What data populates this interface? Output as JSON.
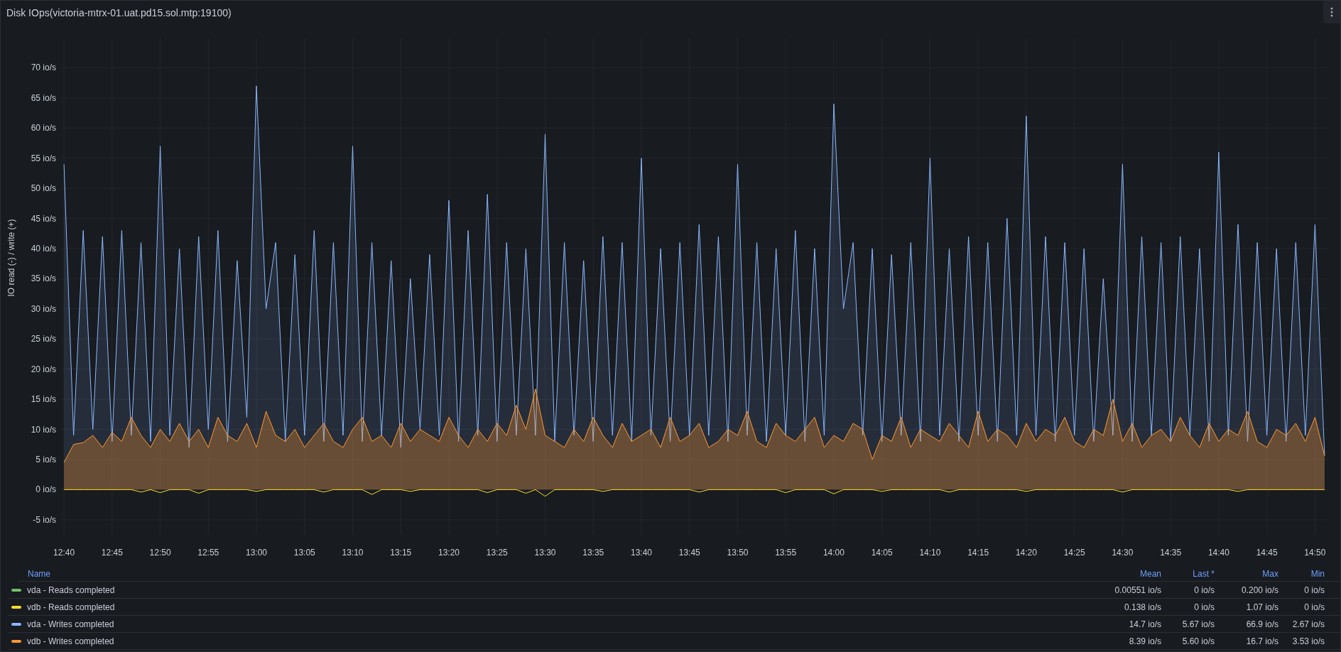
{
  "panel": {
    "title": "Disk IOps(victoria-mtrx-01.uat.pd15.sol.mtp:19100)",
    "chart_data": {
      "type": "area",
      "ylabel": "IO read (-) / write (+)",
      "stacked": false,
      "categories": [
        "12:40",
        null,
        null,
        null,
        null,
        "12:45",
        null,
        null,
        null,
        null,
        "12:50",
        null,
        null,
        null,
        null,
        "12:55",
        null,
        null,
        null,
        null,
        "13:00",
        null,
        null,
        null,
        null,
        "13:05",
        null,
        null,
        null,
        null,
        "13:10",
        null,
        null,
        null,
        null,
        "13:15",
        null,
        null,
        null,
        null,
        "13:20",
        null,
        null,
        null,
        null,
        "13:25",
        null,
        null,
        null,
        null,
        "13:30",
        null,
        null,
        null,
        null,
        "13:35",
        null,
        null,
        null,
        null,
        "13:40",
        null,
        null,
        null,
        null,
        "13:45",
        null,
        null,
        null,
        null,
        "13:50",
        null,
        null,
        null,
        null,
        "13:55",
        null,
        null,
        null,
        null,
        "14:00",
        null,
        null,
        null,
        null,
        "14:05",
        null,
        null,
        null,
        null,
        "14:10",
        null,
        null,
        null,
        null,
        "14:15",
        null,
        null,
        null,
        null,
        "14:20",
        null,
        null,
        null,
        null,
        "14:25",
        null,
        null,
        null,
        null,
        "14:30",
        null,
        null,
        null,
        null,
        "14:35",
        null,
        null,
        null,
        null,
        "14:40",
        null,
        null,
        null,
        null,
        "14:45",
        null,
        null,
        null,
        null,
        "14:50",
        null
      ],
      "ylim": [
        -7.5,
        75
      ],
      "grid": true,
      "yticks": [
        {
          "value": -5,
          "label": "-5 io/s"
        },
        {
          "value": 0,
          "label": "0 io/s"
        },
        {
          "value": 5,
          "label": "5 io/s"
        },
        {
          "value": 10,
          "label": "10 io/s"
        },
        {
          "value": 15,
          "label": "15 io/s"
        },
        {
          "value": 20,
          "label": "20 io/s"
        },
        {
          "value": 25,
          "label": "25 io/s"
        },
        {
          "value": 30,
          "label": "30 io/s"
        },
        {
          "value": 35,
          "label": "35 io/s"
        },
        {
          "value": 40,
          "label": "40 io/s"
        },
        {
          "value": 45,
          "label": "45 io/s"
        },
        {
          "value": 50,
          "label": "50 io/s"
        },
        {
          "value": 55,
          "label": "55 io/s"
        },
        {
          "value": 60,
          "label": "60 io/s"
        },
        {
          "value": 65,
          "label": "65 io/s"
        },
        {
          "value": 70,
          "label": "70 io/s"
        }
      ],
      "series": [
        {
          "name": "vda - Reads completed",
          "type": "line",
          "color": "#73bf69",
          "values": [
            null,
            null,
            null,
            null,
            null,
            null,
            null,
            null,
            null,
            null,
            null,
            null,
            null,
            null,
            null,
            null,
            null,
            null,
            null,
            null,
            null,
            null,
            null,
            null,
            null,
            null,
            null,
            null,
            null,
            null,
            null,
            null,
            null,
            null,
            null,
            null,
            null,
            null,
            null,
            null,
            null,
            null,
            null,
            null,
            null,
            null,
            null,
            null,
            null,
            null,
            null,
            null,
            null,
            null,
            null,
            null,
            null,
            null,
            null,
            null,
            null,
            null,
            null,
            null,
            null,
            null,
            null,
            null,
            null,
            null,
            null,
            null,
            null,
            null,
            null,
            null,
            null,
            null,
            null,
            null,
            null,
            null,
            null,
            null,
            null,
            null,
            null,
            null,
            null,
            null,
            null,
            null,
            null,
            null,
            null,
            null,
            null,
            null,
            null,
            null,
            null,
            null,
            null,
            null,
            null,
            null,
            null,
            null,
            null,
            null,
            null,
            null,
            null,
            null,
            null,
            null,
            null,
            null,
            null,
            null,
            null,
            null,
            null,
            null,
            null,
            null,
            null,
            null,
            null,
            null,
            null,
            null
          ]
        },
        {
          "name": "vdb - Reads completed",
          "type": "line",
          "color": "#fade2a",
          "values": [
            0,
            0,
            0,
            0,
            0,
            0,
            0,
            0,
            -0.4,
            0,
            -0.5,
            0,
            0,
            0,
            -0.6,
            0,
            0,
            0,
            0,
            0,
            -0.3,
            0,
            0,
            0,
            0,
            0,
            0,
            -0.4,
            0,
            0,
            0,
            0,
            -0.8,
            0,
            0,
            0,
            -0.3,
            0,
            0,
            0,
            0,
            0,
            0,
            0,
            -0.5,
            0,
            0,
            0,
            -0.6,
            0,
            -1.1,
            0,
            0,
            0,
            0,
            0,
            -0.3,
            0,
            0,
            0,
            0,
            0,
            0,
            0,
            0,
            0,
            -0.4,
            0,
            0,
            0,
            0,
            0,
            0,
            0,
            0,
            -0.5,
            0,
            0,
            0,
            0,
            -0.7,
            0,
            0,
            0,
            0,
            -0.3,
            0,
            0,
            0,
            0,
            0,
            0,
            -0.4,
            0,
            0,
            0,
            0,
            0,
            0,
            0,
            -0.3,
            0,
            0,
            0,
            0,
            0,
            0,
            0,
            0,
            0,
            -0.4,
            0,
            0,
            0,
            0,
            0,
            0,
            0,
            0,
            0,
            0,
            0,
            -0.3,
            0,
            0,
            0,
            0,
            0,
            0,
            0,
            0,
            0
          ]
        },
        {
          "name": "vda - Writes completed",
          "type": "area",
          "color": "#8ab8ff",
          "values": [
            54,
            9,
            43,
            10,
            42,
            8,
            43,
            9,
            41,
            8,
            57,
            9,
            40,
            7,
            42,
            10,
            43,
            8,
            38,
            12,
            67,
            30,
            41,
            8,
            39,
            9,
            43,
            8,
            41,
            9,
            57,
            8,
            41,
            9,
            38,
            7,
            35,
            10,
            39,
            9,
            48,
            8,
            43,
            9,
            49,
            8,
            41,
            9,
            40,
            9,
            59,
            8,
            41,
            9,
            38,
            8,
            42,
            9,
            41,
            8,
            55,
            9,
            40,
            8,
            41,
            9,
            44,
            9,
            42,
            8,
            54,
            9,
            41,
            8,
            40,
            9,
            43,
            8,
            40,
            9,
            64,
            30,
            41,
            9,
            40,
            8,
            39,
            9,
            41,
            8,
            55,
            9,
            40,
            8,
            42,
            9,
            41,
            8,
            45,
            9,
            62,
            9,
            42,
            8,
            41,
            9,
            40,
            8,
            35,
            9,
            54,
            8,
            42,
            9,
            41,
            8,
            42,
            9,
            40,
            8,
            56,
            9,
            44,
            8,
            41,
            9,
            40,
            8,
            41,
            9,
            44,
            5.7
          ]
        },
        {
          "name": "vdb - Writes completed",
          "type": "area",
          "color": "#ff9830",
          "values": [
            4.5,
            7.5,
            7.8,
            9,
            7,
            9.5,
            8,
            12,
            9,
            7,
            10,
            8,
            11,
            8,
            10,
            7,
            12,
            9,
            8,
            11,
            7,
            13,
            9,
            8,
            10,
            7,
            9,
            11,
            8,
            7,
            10,
            12,
            8,
            9,
            7,
            11,
            8,
            10,
            9,
            8,
            12,
            9,
            7,
            10,
            8,
            11,
            9,
            14,
            10,
            16.7,
            9,
            8,
            7,
            10,
            8,
            12,
            9,
            7,
            11,
            8,
            9,
            10,
            7,
            12,
            8,
            9,
            11,
            7,
            8,
            10,
            9,
            13,
            8,
            7,
            11,
            9,
            8,
            10,
            12,
            7,
            9,
            8,
            11,
            10,
            5,
            9,
            8,
            12,
            7,
            10,
            9,
            8,
            11,
            9,
            7,
            13,
            8,
            10,
            9,
            7,
            11,
            8,
            10,
            9,
            12,
            8,
            7,
            10,
            9,
            15,
            8,
            11,
            7,
            9,
            10,
            8,
            12,
            9,
            7,
            11,
            8,
            10,
            9,
            13,
            8,
            7,
            10,
            9,
            11,
            8,
            12,
            5.6
          ]
        }
      ]
    },
    "legend": {
      "columns": [
        "Name",
        "Mean",
        "Last *",
        "Max",
        "Min"
      ],
      "rows": [
        {
          "mean": "0.00551 io/s",
          "last": "0 io/s",
          "max": "0.200 io/s",
          "min": "0 io/s"
        },
        {
          "mean": "0.138 io/s",
          "last": "0 io/s",
          "max": "1.07 io/s",
          "min": "0 io/s"
        },
        {
          "mean": "14.7 io/s",
          "last": "5.67 io/s",
          "max": "66.9 io/s",
          "min": "2.67 io/s"
        },
        {
          "mean": "8.39 io/s",
          "last": "5.60 io/s",
          "max": "16.7 io/s",
          "min": "3.53 io/s"
        }
      ]
    }
  }
}
